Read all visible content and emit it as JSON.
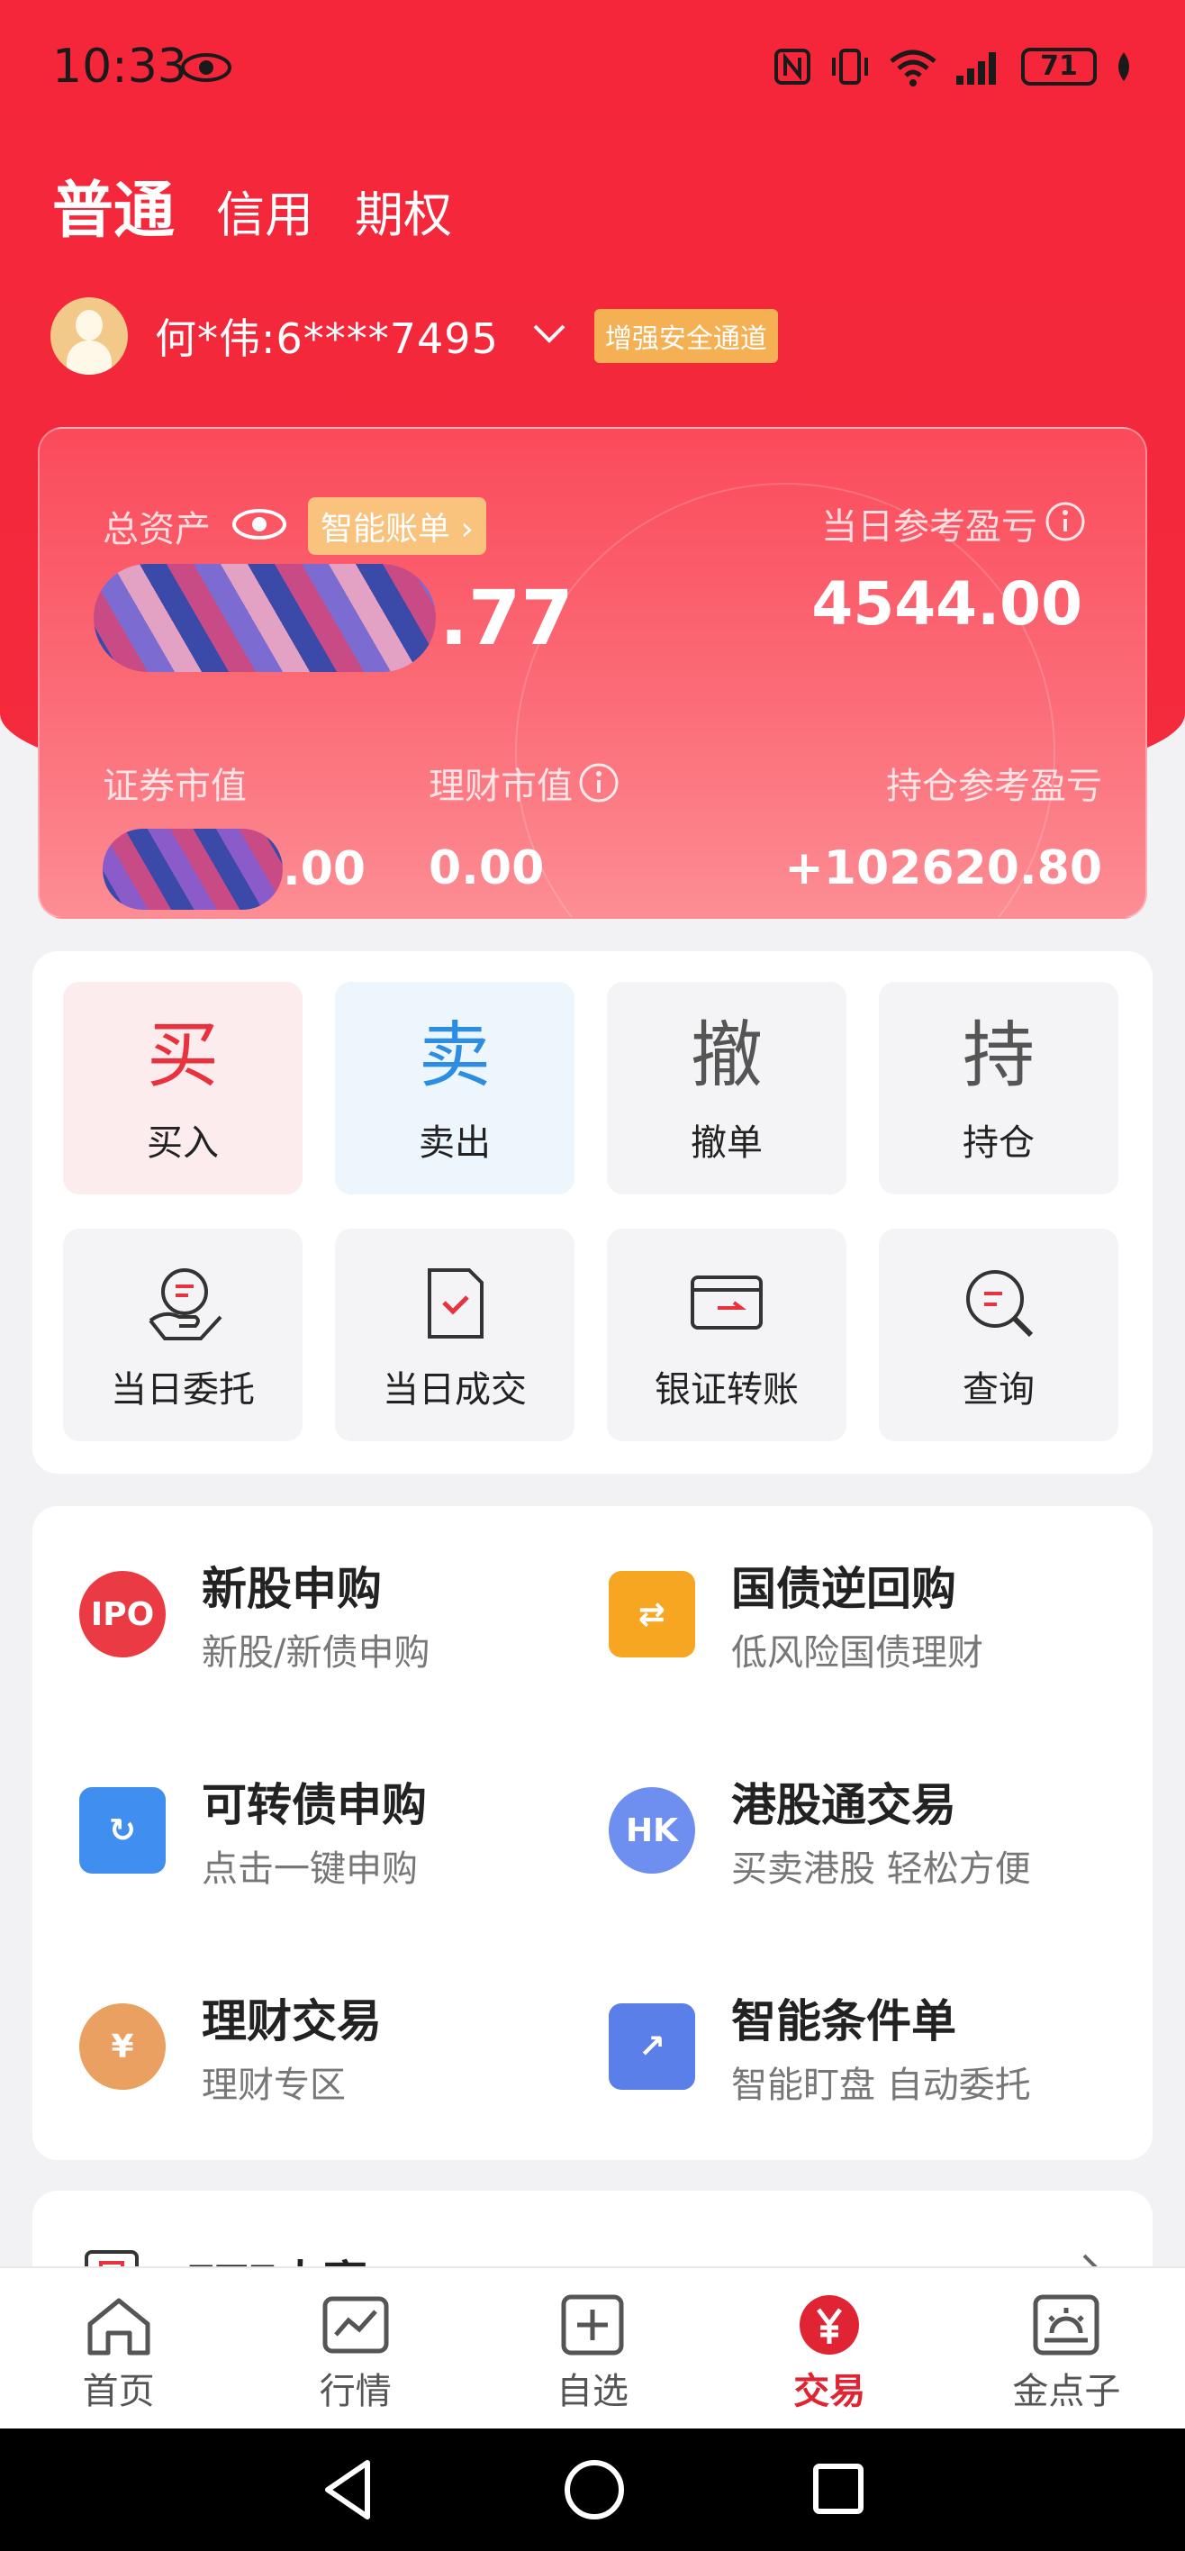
{
  "status": {
    "time": "10:33",
    "battery": "71"
  },
  "account_tabs": [
    "普通",
    "信用",
    "期权"
  ],
  "user": {
    "name": "何*伟:6****7495",
    "secure_badge": "增强安全通道"
  },
  "asset": {
    "total_label": "总资产",
    "smart_bill": "智能账单",
    "total_value_visible": ".77",
    "daily_pl_label": "当日参考盈亏",
    "daily_pl_value": "4544.00",
    "securities_label": "证券市值",
    "securities_value_visible": ".00",
    "wealth_label": "理财市值",
    "wealth_value": "0.00",
    "position_pl_label": "持仓参考盈亏",
    "position_pl_value": "+102620.80"
  },
  "quick": {
    "buy": {
      "glyph": "买",
      "label": "买入"
    },
    "sell": {
      "glyph": "卖",
      "label": "卖出"
    },
    "cancel": {
      "glyph": "撤",
      "label": "撤单"
    },
    "hold": {
      "glyph": "持",
      "label": "持仓"
    },
    "today_orders": "当日委托",
    "today_deals": "当日成交",
    "bank_transfer": "银证转账",
    "query": "查询"
  },
  "services": [
    {
      "title": "新股申购",
      "sub": "新股/新债申购",
      "icon": "IPO"
    },
    {
      "title": "国债逆回购",
      "sub": "低风险国债理财",
      "icon": "repo-icon"
    },
    {
      "title": "可转债申购",
      "sub": "点击一键申购",
      "icon": "convertible-icon"
    },
    {
      "title": "港股通交易",
      "sub": "买卖港股 轻松方便",
      "icon": "HK"
    },
    {
      "title": "理财交易",
      "sub": "理财专区",
      "icon": "¥"
    },
    {
      "title": "智能条件单",
      "sub": "智能盯盘 自动委托",
      "icon": "smart-order-icon"
    }
  ],
  "etf": {
    "title": "ETF大赛"
  },
  "tabs": [
    {
      "label": "首页"
    },
    {
      "label": "行情"
    },
    {
      "label": "自选"
    },
    {
      "label": "交易"
    },
    {
      "label": "金点子"
    }
  ],
  "colors": {
    "brand_red": "#f42a3d",
    "active_tab": "#e02434"
  }
}
